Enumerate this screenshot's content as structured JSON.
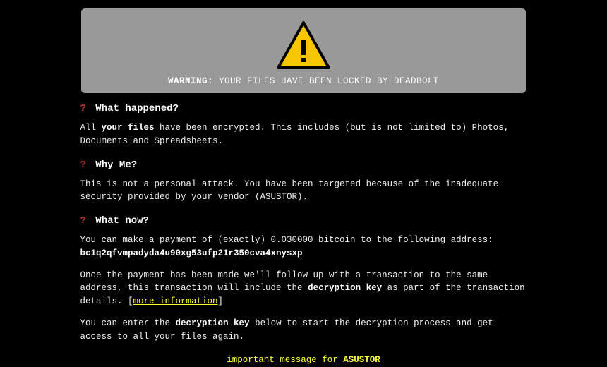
{
  "banner": {
    "warning_label": "WARNING:",
    "warning_text": " YOUR FILES HAVE BEEN LOCKED BY DEADBOLT"
  },
  "sections": {
    "what_happened": {
      "q": "?",
      "title": " What happened?",
      "p1_pre": "All ",
      "p1_bold": "your files",
      "p1_post": " have been encrypted. This includes (but is not limited to) Photos, Documents and Spreadsheets."
    },
    "why_me": {
      "q": "?",
      "title": " Why Me?",
      "p1": "This is not a personal attack. You have been targeted because of the inadequate security provided by your vendor (ASUSTOR)."
    },
    "what_now": {
      "q": "?",
      "title": " What now?",
      "p1": "You can make a payment of (exactly) 0.030000 bitcoin to the following address:",
      "address": "bc1q2qfvmpadyda4u90xg53ufp21r350cva4xnysxp",
      "p2_pre": "Once the payment has been made we'll follow up with a transaction to the same address, this transaction will include the ",
      "p2_bold": "decryption key",
      "p2_post": " as part of the transaction details. [",
      "p2_link": "more information",
      "p2_end": "]",
      "p3_pre": "You can enter the ",
      "p3_bold": "decryption key",
      "p3_post": " below to start the decryption process and get access to all your files again."
    }
  },
  "footer": {
    "link_pre": "important message for ",
    "link_vendor": "ASUSTOR"
  }
}
